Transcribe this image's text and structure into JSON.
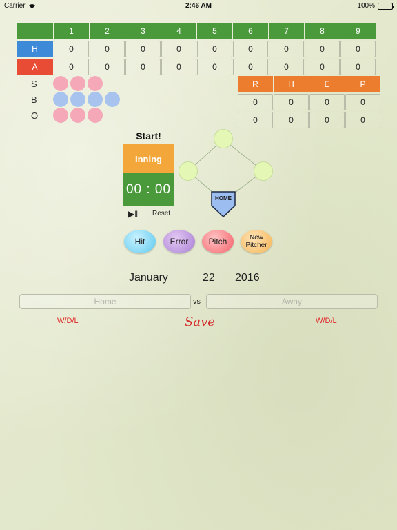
{
  "status_bar": {
    "carrier": "Carrier",
    "time": "2:46 AM",
    "battery": "100%"
  },
  "scoreboard": {
    "innings": [
      "1",
      "2",
      "3",
      "4",
      "5",
      "6",
      "7",
      "8",
      "9"
    ],
    "home": {
      "label": "H",
      "scores": [
        "0",
        "0",
        "0",
        "0",
        "0",
        "0",
        "0",
        "0",
        "0"
      ]
    },
    "away": {
      "label": "A",
      "scores": [
        "0",
        "0",
        "0",
        "0",
        "0",
        "0",
        "0",
        "0",
        "0"
      ]
    }
  },
  "count": {
    "strikes_label": "S",
    "balls_label": "B",
    "outs_label": "O",
    "strike_slots": 3,
    "ball_slots": 4,
    "out_slots": 3
  },
  "rhep": {
    "headers": [
      "R",
      "H",
      "E",
      "P"
    ],
    "home": [
      "0",
      "0",
      "0",
      "0"
    ],
    "away": [
      "0",
      "0",
      "0",
      "0"
    ]
  },
  "game": {
    "start_label": "Start!",
    "inning_label": "Inning",
    "timer": "00 : 00",
    "play_pause_icon": "▶‖",
    "reset_label": "Reset",
    "home_plate_label": "HOME"
  },
  "actions": {
    "hit": "Hit",
    "error": "Error",
    "pitch": "Pitch",
    "new_pitcher_line1": "New",
    "new_pitcher_line2": "Pitcher"
  },
  "date": {
    "month": "January",
    "day": "22",
    "year": "2016"
  },
  "teams": {
    "home_placeholder": "Home",
    "away_placeholder": "Away",
    "vs": "vs",
    "home_wdl": "W/D/L",
    "away_wdl": "W/D/L",
    "save": "Save"
  },
  "colors": {
    "green": "#4a9a3c",
    "blue": "#3c8ad8",
    "red": "#e94c34",
    "orange": "#ec7c2e",
    "inning_orange": "#f3a73a",
    "save_red": "#d42a2a"
  }
}
